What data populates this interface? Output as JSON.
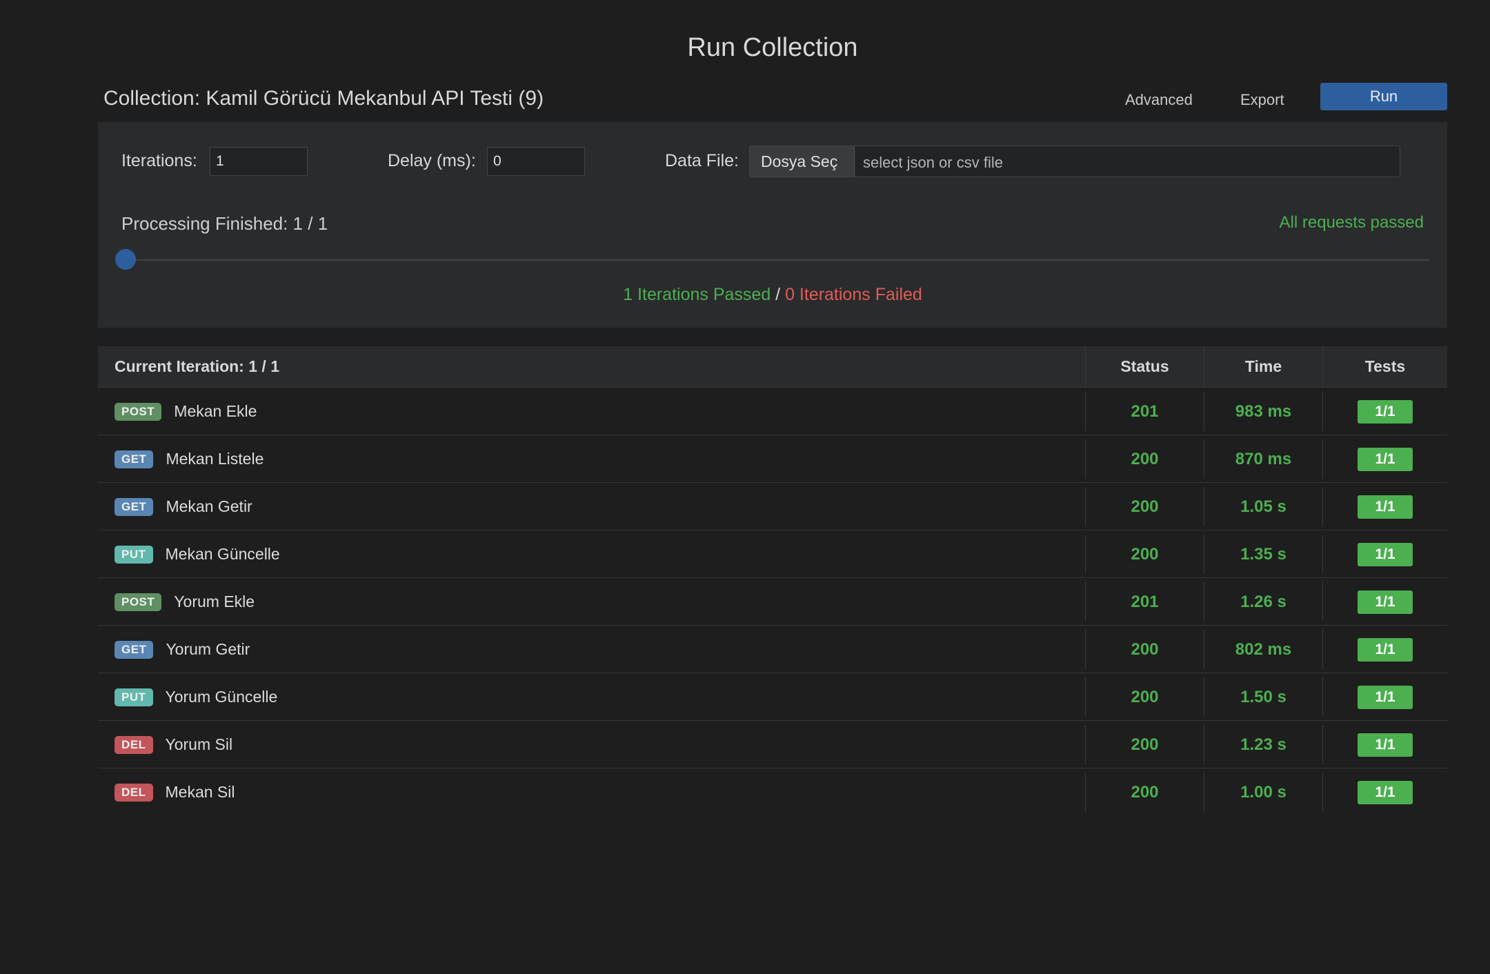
{
  "page": {
    "title": "Run Collection",
    "collection_label": "Collection: Kamil Görücü Mekanbul API Testi (9)",
    "advanced_label": "Advanced",
    "export_label": "Export",
    "run_label": "Run"
  },
  "config": {
    "iterations_label": "Iterations:",
    "iterations_value": "1",
    "delay_label": "Delay (ms):",
    "delay_value": "0",
    "data_file_label": "Data File:",
    "file_button_label": "Dosya Seç",
    "file_placeholder": "select json or csv file"
  },
  "progress": {
    "processing_text": "Processing Finished: 1 / 1",
    "status_text": "All requests passed",
    "value": 0,
    "iterations_passed": "1 Iterations Passed",
    "separator": " / ",
    "iterations_failed": "0 Iterations Failed"
  },
  "results": {
    "header_label": "Current Iteration: 1 / 1",
    "col_status": "Status",
    "col_time": "Time",
    "col_tests": "Tests",
    "rows": [
      {
        "method": "POST",
        "name": "Mekan Ekle",
        "status": "201",
        "time": "983 ms",
        "tests": "1/1"
      },
      {
        "method": "GET",
        "name": "Mekan Listele",
        "status": "200",
        "time": "870 ms",
        "tests": "1/1"
      },
      {
        "method": "GET",
        "name": "Mekan Getir",
        "status": "200",
        "time": "1.05 s",
        "tests": "1/1"
      },
      {
        "method": "PUT",
        "name": "Mekan Güncelle",
        "status": "200",
        "time": "1.35 s",
        "tests": "1/1"
      },
      {
        "method": "POST",
        "name": "Yorum Ekle",
        "status": "201",
        "time": "1.26 s",
        "tests": "1/1"
      },
      {
        "method": "GET",
        "name": "Yorum Getir",
        "status": "200",
        "time": "802 ms",
        "tests": "1/1"
      },
      {
        "method": "PUT",
        "name": "Yorum Güncelle",
        "status": "200",
        "time": "1.50 s",
        "tests": "1/1"
      },
      {
        "method": "DEL",
        "name": "Yorum Sil",
        "status": "200",
        "time": "1.23 s",
        "tests": "1/1"
      },
      {
        "method": "DEL",
        "name": "Mekan Sil",
        "status": "200",
        "time": "1.00 s",
        "tests": "1/1"
      }
    ]
  },
  "colors": {
    "accent": "#2d5f9e",
    "success": "#4caf50",
    "failure": "#e05c55"
  }
}
